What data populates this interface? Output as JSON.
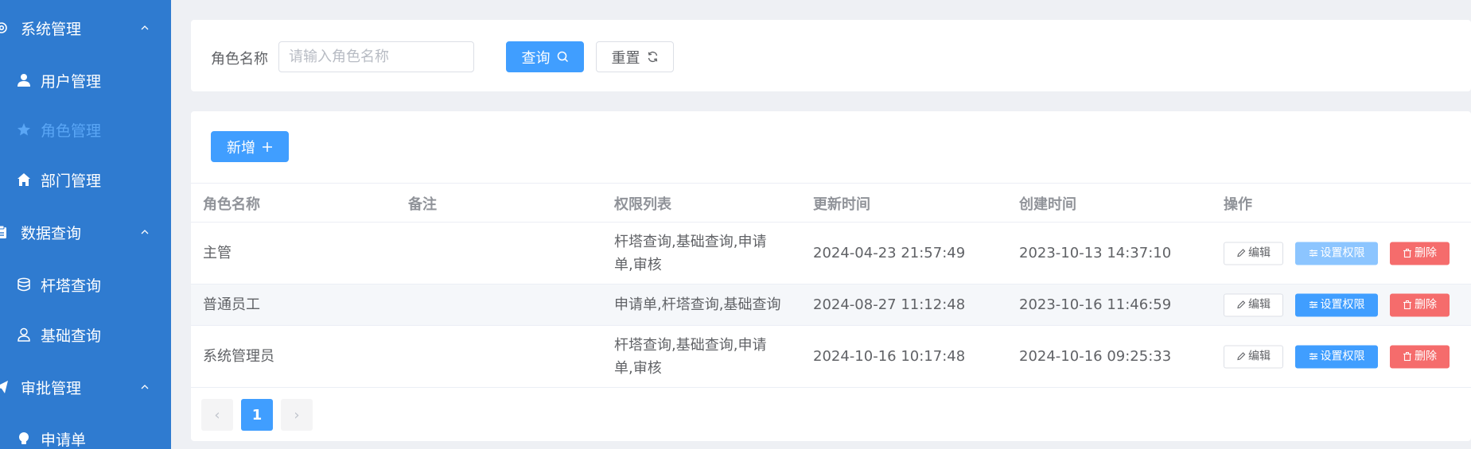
{
  "sidebar": {
    "groups": [
      {
        "label": "系统管理",
        "icon": "gear-icon",
        "expanded": true
      },
      {
        "label": "数据查询",
        "icon": "clipboard-icon",
        "expanded": true
      },
      {
        "label": "审批管理",
        "icon": "paper-plane-icon",
        "expanded": true
      }
    ],
    "items": [
      {
        "label": "用户管理",
        "icon": "user-icon",
        "active": false
      },
      {
        "label": "角色管理",
        "icon": "star-icon",
        "active": true
      },
      {
        "label": "部门管理",
        "icon": "house-icon",
        "active": false
      },
      {
        "label": "杆塔查询",
        "icon": "database-icon",
        "active": false
      },
      {
        "label": "基础查询",
        "icon": "person-outline-icon",
        "active": false
      },
      {
        "label": "申请单",
        "icon": "bulb-icon",
        "active": false
      }
    ]
  },
  "search": {
    "label": "角色名称",
    "placeholder": "请输入角色名称",
    "value": "",
    "query_label": "查询",
    "reset_label": "重置"
  },
  "toolbar": {
    "add_label": "新增"
  },
  "table": {
    "columns": [
      "角色名称",
      "备注",
      "权限列表",
      "更新时间",
      "创建时间",
      "操作"
    ],
    "rows": [
      {
        "name": "主管",
        "remark": "",
        "permissions": "杆塔查询,基础查询,申请单,审核",
        "updated": "2024-04-23 21:57:49",
        "created": "2023-10-13 14:37:10"
      },
      {
        "name": "普通员工",
        "remark": "",
        "permissions": "申请单,杆塔查询,基础查询",
        "updated": "2024-08-27 11:12:48",
        "created": "2023-10-16 11:46:59"
      },
      {
        "name": "系统管理员",
        "remark": "",
        "permissions": "杆塔查询,基础查询,申请单,审核",
        "updated": "2024-10-16 10:17:48",
        "created": "2024-10-16 09:25:33"
      }
    ],
    "actions": {
      "edit": "编辑",
      "set_permission": "设置权限",
      "delete": "删除"
    }
  },
  "pagination": {
    "current_page": "1",
    "prev_symbol": "‹",
    "next_symbol": "›"
  },
  "colors": {
    "sidebar_bg": "#2f7bd0",
    "primary": "#409eff",
    "danger": "#f56c6c",
    "active_menu_text": "#5aa6f5"
  }
}
